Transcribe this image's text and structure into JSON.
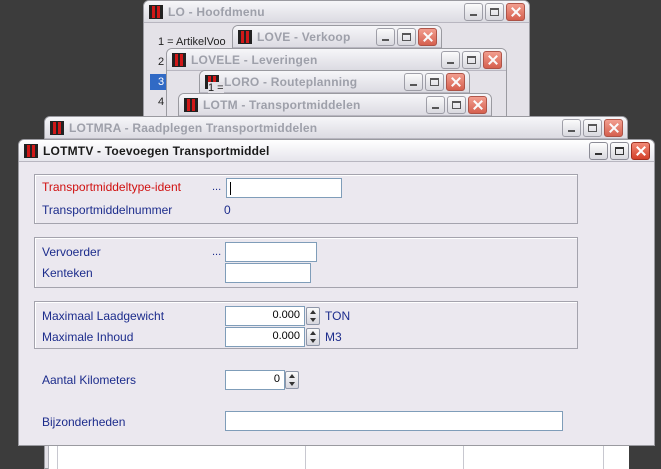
{
  "windows": {
    "lo": {
      "title": "LO - Hoofdmenu",
      "rows": [
        "1 = ArtikelVoo",
        "2",
        "3",
        "4"
      ]
    },
    "love": {
      "title": "LOVE - Verkoop"
    },
    "lovele": {
      "title": "LOVELE - Leveringen"
    },
    "loro": {
      "title": "LORO - Routeplanning",
      "rows": [
        "1 ="
      ]
    },
    "lotm": {
      "title": "LOTM - Transportmiddelen"
    },
    "lotmra": {
      "title": "LOTMRA - Raadplegen Transportmiddelen"
    },
    "lotmtv": {
      "title": "LOTMTV - Toevoegen Transportmiddel"
    }
  },
  "form": {
    "ident_label": "Transportmiddeltype-ident",
    "ident_dots": "...",
    "ident_value": "",
    "nummer_label": "Transportmiddelnummer",
    "nummer_value": "0",
    "vervoerder_label": "Vervoerder",
    "vervoerder_dots": "...",
    "vervoerder_value": "",
    "kenteken_label": "Kenteken",
    "kenteken_value": "",
    "laadgewicht_label": "Maximaal Laadgewicht",
    "laadgewicht_value": "0.000",
    "laadgewicht_unit": "TON",
    "inhoud_label": "Maximale Inhoud",
    "inhoud_value": "0.000",
    "inhoud_unit": "M3",
    "kilometers_label": "Aantal Kilometers",
    "kilometers_value": "0",
    "bijzonderheden_label": "Bijzonderheden",
    "bijzonderheden_value": ""
  },
  "colors": {
    "required_label": "#d01010",
    "label": "#1c2c8c",
    "selection": "#316ac5"
  }
}
